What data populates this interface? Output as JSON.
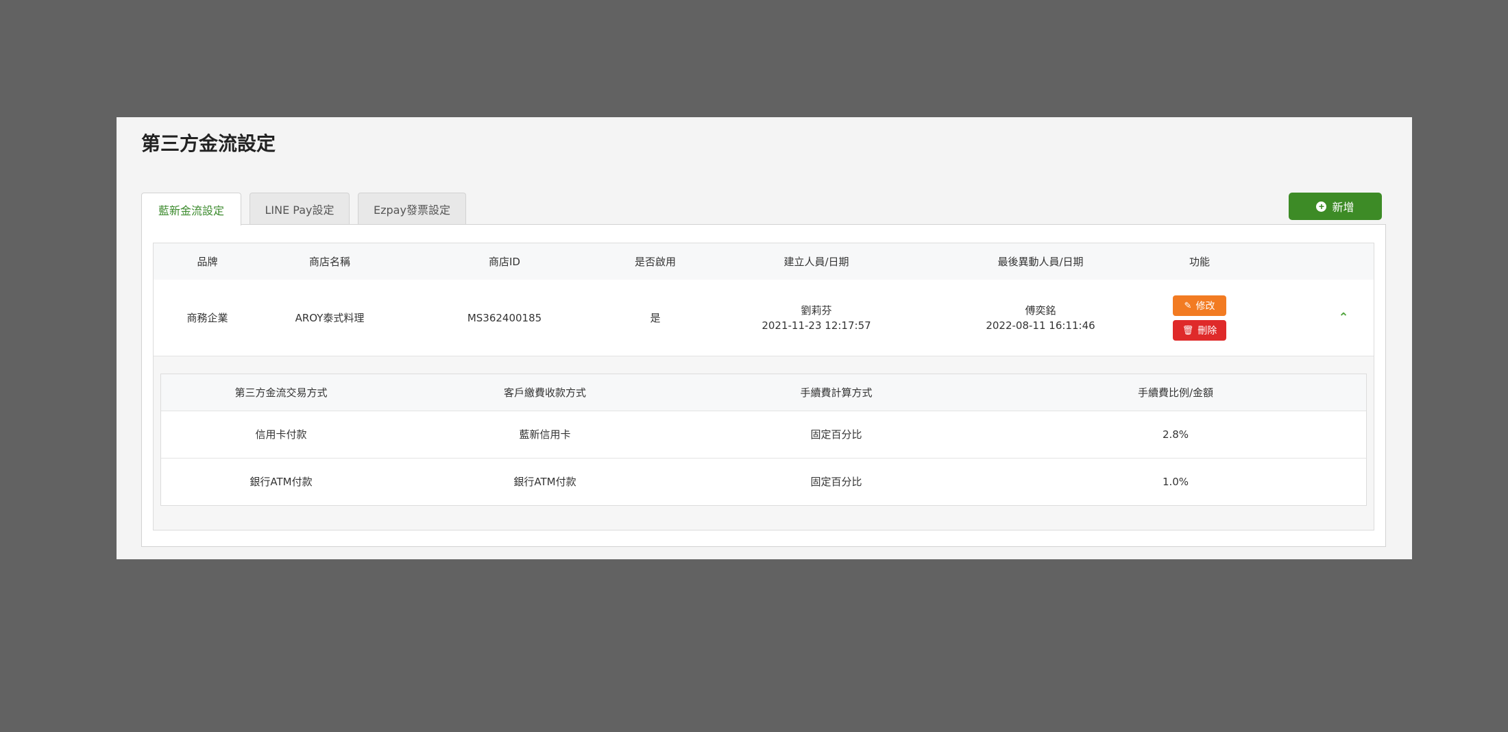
{
  "page_title": "第三方金流設定",
  "tabs": [
    {
      "label": "藍新金流設定",
      "active": true
    },
    {
      "label": "LINE Pay設定",
      "active": false
    },
    {
      "label": "Ezpay發票設定",
      "active": false
    }
  ],
  "add_button": {
    "label": "新增",
    "icon": "plus-circle-icon"
  },
  "main_table": {
    "headers": [
      "品牌",
      "商店名稱",
      "商店ID",
      "是否啟用",
      "建立人員/日期",
      "最後異動人員/日期",
      "功能"
    ],
    "row": {
      "brand": "商務企業",
      "store_name": "AROY泰式料理",
      "store_id": "MS362400185",
      "enabled": "是",
      "creator": "劉莉芬",
      "created_at": "2021-11-23 12:17:57",
      "modifier": "傅奕銘",
      "modified_at": "2022-08-11 16:11:46",
      "edit_label": "修改",
      "delete_label": "刪除"
    }
  },
  "detail_table": {
    "headers": [
      "第三方金流交易方式",
      "客戶繳費收款方式",
      "手續費計算方式",
      "手續費比例/金額"
    ],
    "rows": [
      [
        "信用卡付款",
        "藍新信用卡",
        "固定百分比",
        "2.8%"
      ],
      [
        "銀行ATM付款",
        "銀行ATM付款",
        "固定百分比",
        "1.0%"
      ]
    ]
  },
  "colors": {
    "accent_green": "#3d8b26",
    "edit_orange": "#f27b22",
    "delete_red": "#df2a2a",
    "chevron_green": "#4fa33b"
  }
}
